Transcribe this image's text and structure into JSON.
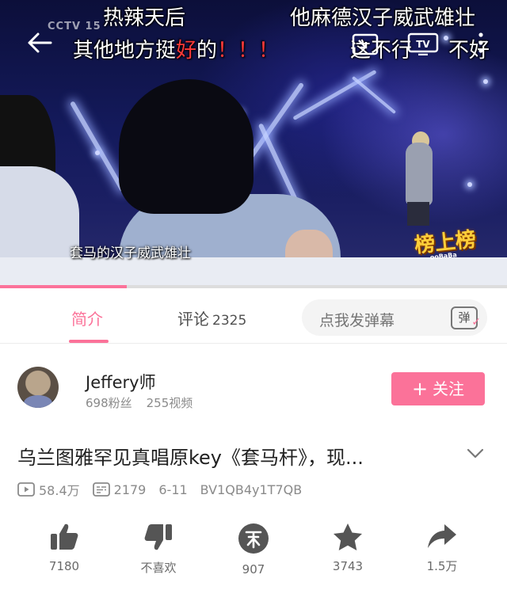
{
  "player": {
    "danmaku": [
      {
        "text": "热辣天后"
      },
      {
        "text": "他麻德汉子威武雄壮"
      },
      {
        "text_prefix": "其他地方挺",
        "text_highlight": "好",
        "text_suffix": "的",
        "text_exclaim": "！！！"
      },
      {
        "text": "这不行"
      },
      {
        "text": "不好"
      }
    ],
    "subtitle": "套马的汉子威武雄壮",
    "station_logo": "CCTV 15",
    "show_logo": "榜上榜",
    "show_logo_sub": "ooBaBa",
    "progress_fraction": 0.25
  },
  "tabs": {
    "intro_label": "简介",
    "comments_label": "评论",
    "comments_count": "2325",
    "danmu_placeholder": "点我发弹幕",
    "danmu_icon_char": "弹"
  },
  "uploader": {
    "name": "Jeffery师",
    "fans": "698粉丝",
    "videos": "255视频",
    "follow_label": "关注"
  },
  "video": {
    "title": "乌兰图雅罕见真唱原key《套马杆》，现...",
    "views": "58.4万",
    "danmaku_count": "2179",
    "date": "6-11",
    "bvid": "BV1QB4y1T7QB"
  },
  "actions": {
    "like": "7180",
    "dislike": "不喜欢",
    "coin": "907",
    "favorite": "3743",
    "share": "1.5万"
  },
  "colors": {
    "accent": "#fb7299",
    "icon_gray": "#555555"
  },
  "icons": {
    "back": "back-arrow-icon",
    "pip": "picture-in-picture-icon",
    "tv": "tv-cast-icon",
    "more": "more-vertical-icon",
    "expand": "chevron-down-icon",
    "views": "play-count-icon",
    "danmaku": "danmaku-count-icon",
    "like": "thumbs-up-icon",
    "dislike": "thumbs-down-icon",
    "coin": "coin-icon",
    "favorite": "star-icon",
    "share": "share-arrow-icon"
  }
}
